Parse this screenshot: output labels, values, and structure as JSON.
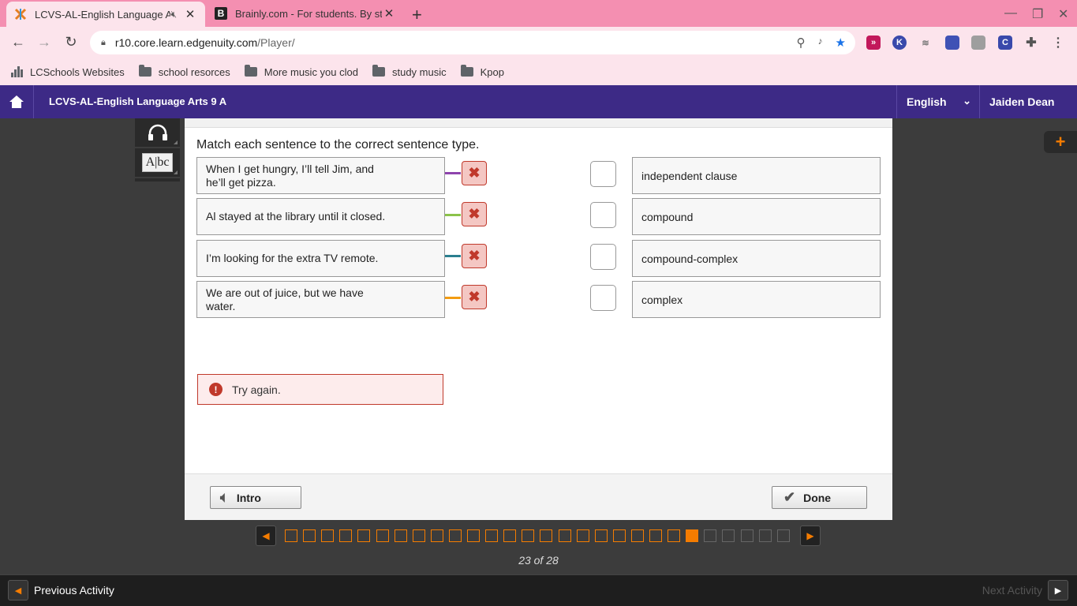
{
  "browser": {
    "tabs": [
      {
        "title": "LCVS-AL-English Language A",
        "active": true
      },
      {
        "title": "Brainly.com - For students. By st",
        "active": false
      }
    ],
    "url_host": "r10.core.learn.edgenuity.com",
    "url_path": "/Player/",
    "bookmarks": [
      "LCSchools Websites",
      "school resorces",
      "More music you clod",
      "study music",
      "Kpop"
    ]
  },
  "header": {
    "course_title": "LCVS-AL-English Language Arts 9 A",
    "language": "English",
    "user_name": "Jaiden Dean"
  },
  "activity": {
    "instruction": "Match each sentence to the correct sentence type.",
    "prompts": [
      {
        "text": "When I get hungry, I’ll tell Jim, and he’ll get pizza.",
        "line_color": "#8e44ad"
      },
      {
        "text": "Al stayed at the library until it closed.",
        "line_color": "#8bc34a"
      },
      {
        "text": "I’m looking for the extra TV remote.",
        "line_color": "#2a7f8f"
      },
      {
        "text": "We are out of juice, but we have water.",
        "line_color": "#f39c12"
      }
    ],
    "answers": [
      "independent clause",
      "compound",
      "compound-complex",
      "complex"
    ],
    "feedback": "Try again.",
    "intro_label": "Intro",
    "done_label": "Done"
  },
  "pager": {
    "total": 28,
    "current": 23,
    "label": "23 of 28"
  },
  "bottom": {
    "previous_label": "Previous Activity",
    "next_label": "Next Activity"
  },
  "colors": {
    "tabstrip": "#f48fb1",
    "appbar": "#3d2a86",
    "accent": "#f57c00",
    "error": "#c0392b"
  }
}
